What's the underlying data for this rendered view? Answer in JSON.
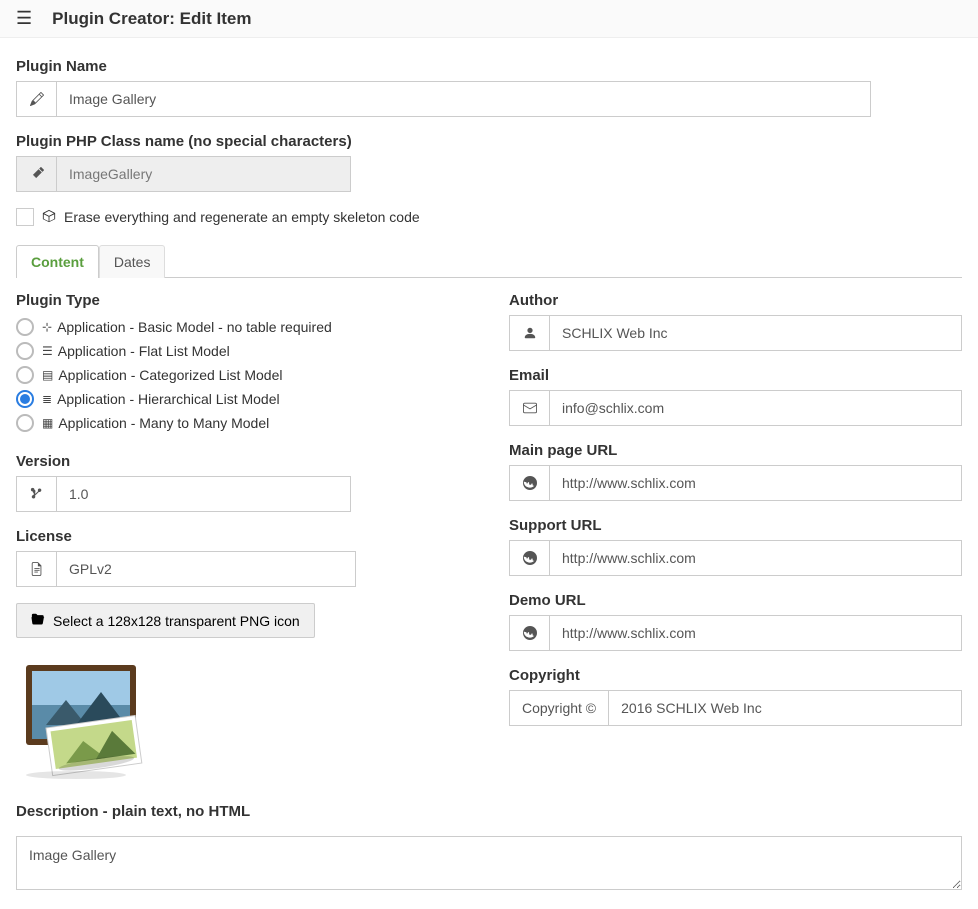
{
  "header": {
    "title": "Plugin Creator: Edit Item"
  },
  "form": {
    "plugin_name": {
      "label": "Plugin Name",
      "value": "Image Gallery"
    },
    "class_name": {
      "label": "Plugin PHP Class name (no special characters)",
      "value": "ImageGallery"
    },
    "erase_checkbox": {
      "label": "Erase everything and regenerate an empty skeleton code"
    },
    "version": {
      "label": "Version",
      "value": "1.0"
    },
    "license": {
      "label": "License",
      "value": "GPLv2"
    },
    "icon_button": {
      "label": "Select a 128x128 transparent PNG icon"
    },
    "description": {
      "label": "Description - plain text, no HTML",
      "value": "Image Gallery"
    },
    "author": {
      "label": "Author",
      "value": "SCHLIX Web Inc"
    },
    "email": {
      "label": "Email",
      "value": "info@schlix.com"
    },
    "main_url": {
      "label": "Main page URL",
      "value": "http://www.schlix.com"
    },
    "support_url": {
      "label": "Support URL",
      "value": "http://www.schlix.com"
    },
    "demo_url": {
      "label": "Demo URL",
      "value": "http://www.schlix.com"
    },
    "copyright": {
      "label": "Copyright",
      "addon": "Copyright ©",
      "value": "2016 SCHLIX Web Inc"
    }
  },
  "tabs": [
    {
      "label": "Content",
      "active": true
    },
    {
      "label": "Dates",
      "active": false
    }
  ],
  "plugin_type": {
    "label": "Plugin Type",
    "options": [
      {
        "text": "Application - Basic Model - no table required",
        "checked": false
      },
      {
        "text": "Application - Flat List Model",
        "checked": false
      },
      {
        "text": "Application - Categorized List Model",
        "checked": false
      },
      {
        "text": "Application - Hierarchical List Model",
        "checked": true
      },
      {
        "text": "Application - Many to Many Model",
        "checked": false
      }
    ]
  }
}
